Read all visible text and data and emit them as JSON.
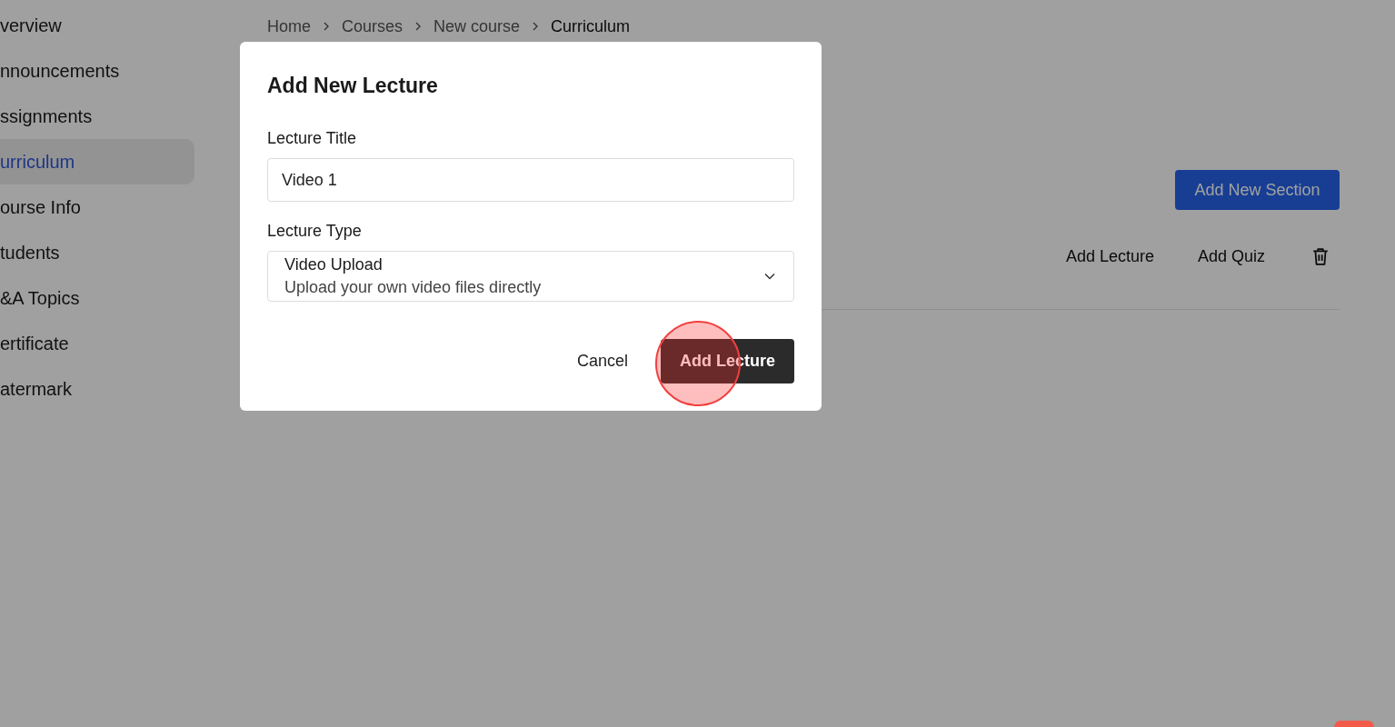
{
  "sidebar": {
    "items": [
      {
        "label": "verview",
        "selected": false
      },
      {
        "label": "nnouncements",
        "selected": false
      },
      {
        "label": "ssignments",
        "selected": false
      },
      {
        "label": "urriculum",
        "selected": true
      },
      {
        "label": "ourse Info",
        "selected": false
      },
      {
        "label": "tudents",
        "selected": false
      },
      {
        "label": "&A Topics",
        "selected": false
      },
      {
        "label": "ertificate",
        "selected": false
      },
      {
        "label": "atermark",
        "selected": false
      }
    ]
  },
  "breadcrumbs": [
    "Home",
    "Courses",
    "New course",
    "Curriculum"
  ],
  "add_section_button": "Add New Section",
  "section": {
    "actions": [
      "Add Lecture",
      "Add Quiz"
    ]
  },
  "dialog": {
    "title": "Add New Lecture",
    "fields": [
      {
        "kind": "text",
        "label": "Lecture Title",
        "value": "Video 1"
      },
      {
        "kind": "select",
        "label": "Lecture Type",
        "value": "Video Upload",
        "description": "Upload your own video files directly"
      }
    ],
    "buttons": [
      {
        "label": "Cancel",
        "kind": "secondary"
      },
      {
        "label": "Add Lecture",
        "kind": "primary"
      }
    ]
  }
}
